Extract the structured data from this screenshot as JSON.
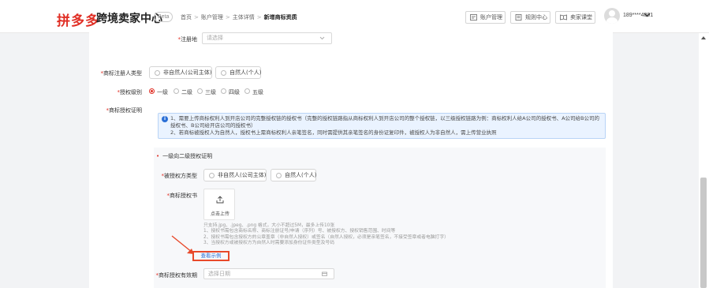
{
  "header": {
    "logo": "拼多多",
    "app_title": "跨境卖家中心",
    "beta": "Beta",
    "breadcrumbs": [
      "首页",
      "账户管理",
      "主体详情",
      "新增商标资质"
    ],
    "buttons": [
      {
        "label": "账户管理",
        "icon": "account-icon"
      },
      {
        "label": "规则中心",
        "icon": "rules-icon"
      },
      {
        "label": "卖家课堂",
        "icon": "classroom-icon"
      }
    ],
    "user_phone": "189****4801"
  },
  "form": {
    "registration_place": {
      "label": "注册地",
      "placeholder": "请选择"
    },
    "owner_type": {
      "label": "商标注册人类型",
      "options": [
        "非自然人(公司主体)",
        "自然人(个人)"
      ]
    },
    "auth_level": {
      "label": "授权级别",
      "options": [
        "一级",
        "二级",
        "三级",
        "四级",
        "五级"
      ],
      "selected": "一级"
    },
    "auth_proof": {
      "label": "商标授权证明"
    },
    "notice": {
      "line1": "1、需要上传商标权利人到开店公司的完整授权链的授权书（完整的授权链路指从商标权利人到开店公司的整个授权链，以三级授权链路为例：商标权利人给A公司的授权书、A公司给B公司的授权书、B公司给开店公司的授权书）",
      "line2": "2、若商标被授权人为自然人，授权书上需商标权利人亲笔签名，同时需提供其亲笔签名的身份证复印件，被授权人为非自然人，需上传营业执照"
    },
    "section": {
      "title": "一级向二级授权证明",
      "grantee_type": {
        "label": "被授权方类型",
        "options": [
          "非自然人(公司主体)",
          "自然人(个人)"
        ]
      },
      "auth_letter": {
        "label": "商标授权书",
        "upload_label": "点击上传"
      },
      "tips": [
        "只支持.jpg、.jpeg、.png 格式，大小不超过5M，最多上传10张",
        "1、授权书需包含商标名称、商标注册证号/申请（序列）号、被授权方、授权销售范围、时间等",
        "2、授权书需包含授权方的公章盖章（非自然人授权）或签名（自然人授权，必须是亲笔签名，不接受签章或者电脑打字）",
        "3、当授权方或被授权方为自然人时需要添加身份证件类型及号码"
      ],
      "example_link": "查看示例",
      "validity": {
        "label": "商标授权有效期",
        "placeholder": "选择日期"
      }
    }
  },
  "colors": {
    "brand": "#e02e24",
    "link": "#2a6fd6",
    "notice_bg": "#eaf3ff",
    "highlight": "#e8492a"
  }
}
